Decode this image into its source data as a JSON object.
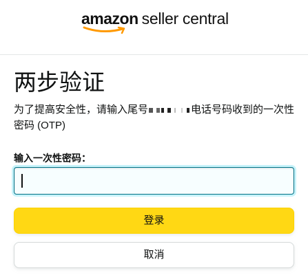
{
  "header": {
    "logo_brand": "amazon",
    "logo_product": "seller central"
  },
  "page": {
    "title": "两步验证",
    "description_before": "为了提高安全性，请输入尾号",
    "description_after": "电话号码收到的一次性密码 (OTP)",
    "otp_label": "输入一次性密码：",
    "otp_value": ""
  },
  "buttons": {
    "sign_in_label": "登录",
    "cancel_label": "取消"
  },
  "colors": {
    "primary_button": "#ffd814",
    "focus_border": "#007185",
    "smile": "#ff9900"
  }
}
